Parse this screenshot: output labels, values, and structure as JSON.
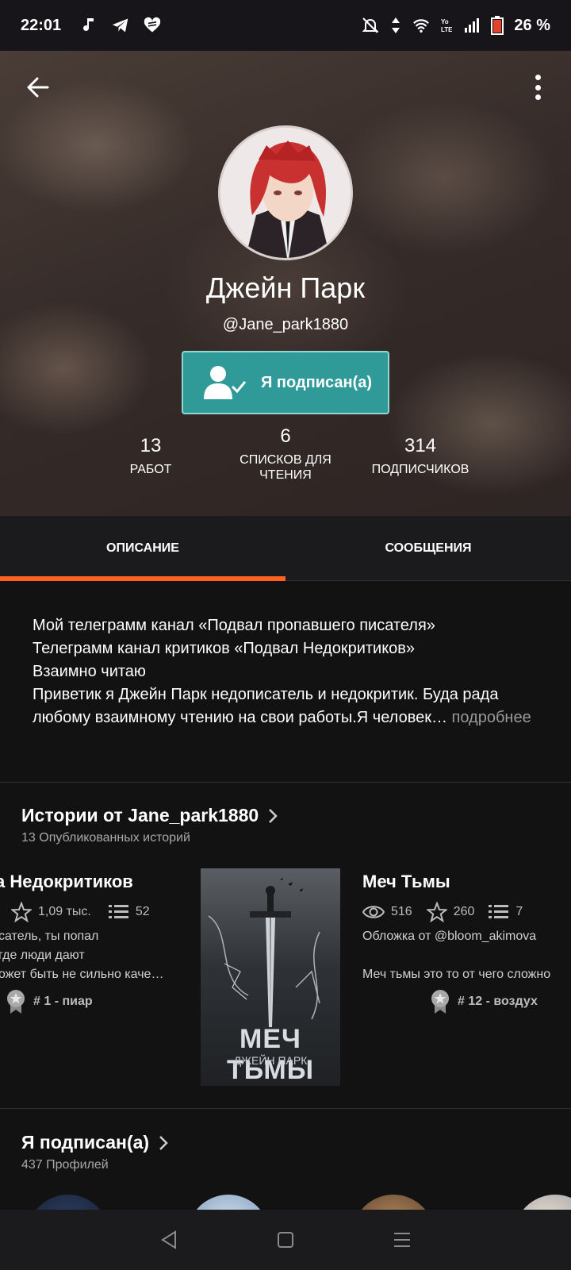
{
  "status_bar": {
    "time": "22:01",
    "battery_percent": "26 %",
    "left_icons": [
      "music-note-icon",
      "telegram-icon",
      "heart-icon"
    ],
    "right_icons": [
      "mute-alarm-icon",
      "data-arrows-icon",
      "wifi-icon",
      "volte-icon",
      "signal-icon",
      "battery-icon"
    ]
  },
  "profile": {
    "name": "Джейн Парк",
    "handle": "@Jane_park1880",
    "follow_label": "Я подписан(а)"
  },
  "stats": [
    {
      "value": "13",
      "label": "РАБОТ"
    },
    {
      "value": "6",
      "label": "СПИСКОВ ДЛЯ ЧТЕНИЯ"
    },
    {
      "value": "314",
      "label": "ПОДПИСЧИКОВ"
    }
  ],
  "tabs": [
    {
      "label": "ОПИСАНИЕ",
      "active": true
    },
    {
      "label": "СООБЩЕНИЯ",
      "active": false
    }
  ],
  "description": {
    "lines": [
      "Мой телеграмм канал «Подвал пропавшего писателя»",
      "Телеграмм канал критиков «Подвал Недокритиков»",
      "Взаимно читаю",
      "Приветик я Джейн Парк недописатель и недокритик. Буда рада",
      "любому взаимному чтению на свои работы.Я человек…"
    ],
    "more_label": " подробнее"
  },
  "stories_section": {
    "title": "Истории от Jane_park1880",
    "subtitle": "13 Опубликованных историй",
    "stories": [
      {
        "title": "а Недокритиков",
        "stars": "1,09 тыс.",
        "parts": "52",
        "text_lines": [
          "сатель, ты попал",
          "где люди дают",
          "ожет быть не сильно каче…"
        ],
        "tag": "# 1 - пиар"
      },
      {
        "cover_title": "МЕЧ ТЬМЫ",
        "cover_author": "ДЖЕЙН ПАРК",
        "title": "Меч Тьмы",
        "views": "516",
        "stars": "260",
        "parts": "7",
        "text_lines": [
          "Обложка от @bloom_akimova",
          "",
          "Меч тьмы это то от чего сложно"
        ],
        "tag": "# 12 - воздух"
      }
    ]
  },
  "following_section": {
    "title": "Я подписан(а)",
    "subtitle": "437 Профилей"
  },
  "colors": {
    "accent": "#ff6122",
    "follow_button": "#2f9a98",
    "background": "#121212"
  }
}
